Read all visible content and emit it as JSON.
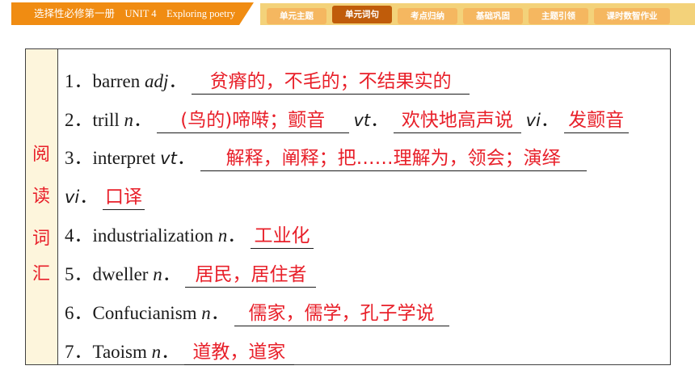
{
  "header": {
    "course_label": "选择性必修第一册　UNIT 4　Exploring poetry",
    "tabs": [
      {
        "label": "单元主题",
        "active": false
      },
      {
        "label": "单元词句",
        "active": true
      },
      {
        "label": "考点归纳",
        "active": false
      },
      {
        "label": "基础巩固",
        "active": false
      },
      {
        "label": "主题引领",
        "active": false
      },
      {
        "label": "课时数智作业",
        "active": false
      }
    ]
  },
  "sidebar": {
    "chars": [
      "阅",
      "读",
      "词",
      "汇"
    ]
  },
  "entries": {
    "e1": {
      "num": "1．",
      "word": "barren ",
      "pos": "adj",
      "sep": "．",
      "answer": "贫瘠的，不毛的；不结果实的"
    },
    "e2": {
      "num": "2．",
      "word": "trill ",
      "pos": "n",
      "sep": "．",
      "answer": "(鸟的)啼啭；颤音",
      "pos2": "vt",
      "sep2": "．",
      "answer2": "欢快地高声说",
      "pos3": "vi",
      "sep3": "．",
      "answer3": "发颤音"
    },
    "e3": {
      "num": "3．",
      "word": "interpret ",
      "pos": "vt",
      "sep": "．",
      "answer": "解释，阐释；把……理解为，领会；演绎",
      "pos2": "vi",
      "sep2": "．",
      "answer2": "口译"
    },
    "e4": {
      "num": "4．",
      "word": "industrialization ",
      "pos": "n",
      "sep": "．",
      "answer": "工业化"
    },
    "e5": {
      "num": "5．",
      "word": "dweller ",
      "pos": "n",
      "sep": "．",
      "answer": "居民，居住者"
    },
    "e6": {
      "num": "6．",
      "word": "Confucianism ",
      "pos": "n",
      "sep": "．",
      "answer": "儒家，儒学，孔子学说"
    },
    "e7": {
      "num": "7．",
      "word": "Taoism ",
      "pos": "n",
      "sep": "．",
      "answer": "道教，道家"
    }
  },
  "colors": {
    "accent_orange": "#f08c12",
    "active_tab": "#c05c0a",
    "answer_red": "#e8202a",
    "side_bg": "#fdf5dc"
  }
}
